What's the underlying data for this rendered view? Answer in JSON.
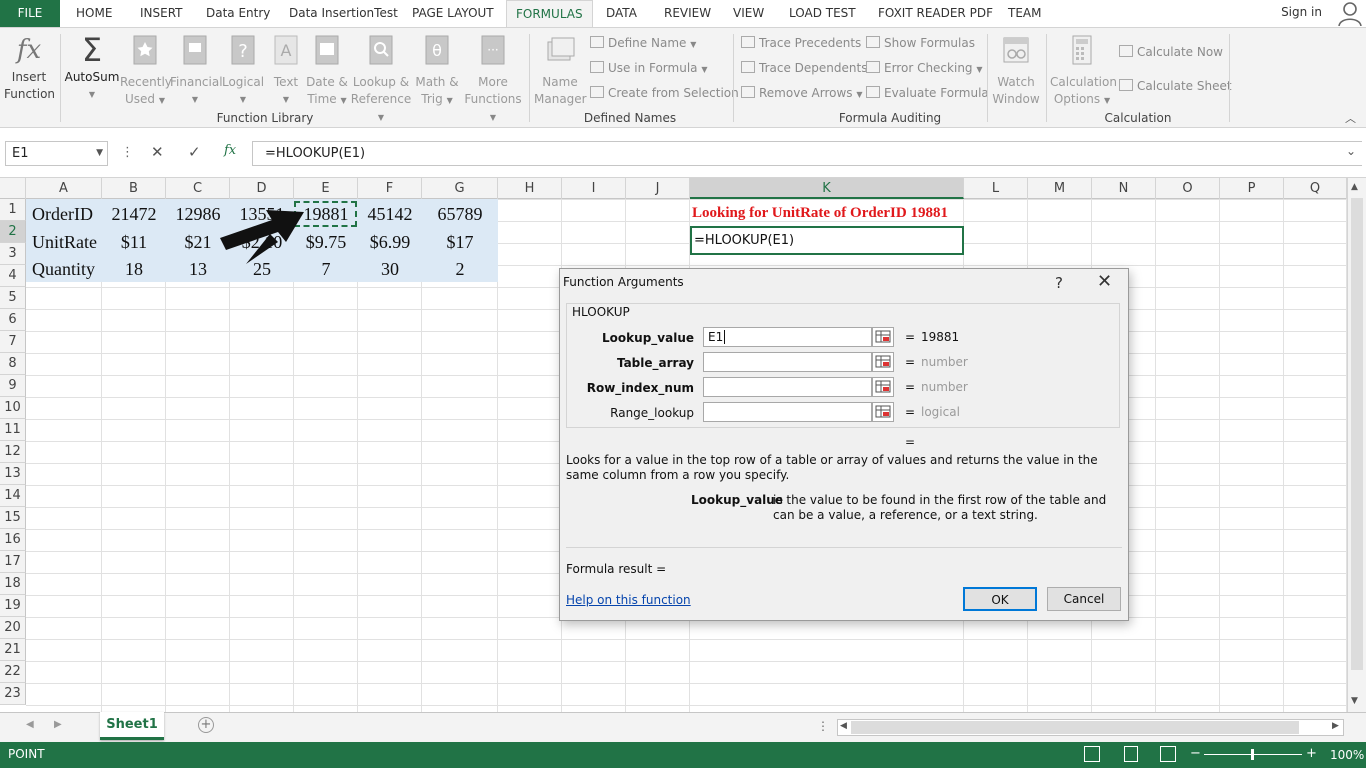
{
  "ribbon_tabs": [
    "FILE",
    "HOME",
    "INSERT",
    "Data Entry",
    "Data InsertionTest",
    "PAGE LAYOUT",
    "FORMULAS",
    "DATA",
    "REVIEW",
    "VIEW",
    "LOAD TEST",
    "FOXIT READER PDF",
    "TEAM"
  ],
  "active_tab": "FORMULAS",
  "sign_in": "Sign in",
  "ribbon": {
    "insert_function": [
      "Insert",
      "Function"
    ],
    "autosum": "AutoSum",
    "recently_used": [
      "Recently",
      "Used"
    ],
    "financial": "Financial",
    "logical": "Logical",
    "text": "Text",
    "date_time": [
      "Date &",
      "Time"
    ],
    "lookup_ref": [
      "Lookup &",
      "Reference"
    ],
    "math_trig": [
      "Math &",
      "Trig"
    ],
    "more_functions": [
      "More",
      "Functions"
    ],
    "group_function_library": "Function Library",
    "name_manager": [
      "Name",
      "Manager"
    ],
    "define_name": "Define Name",
    "use_in_formula": "Use in Formula",
    "create_from_selection": "Create from Selection",
    "group_defined_names": "Defined Names",
    "trace_precedents": "Trace Precedents",
    "trace_dependents": "Trace Dependents",
    "remove_arrows": "Remove Arrows",
    "show_formulas": "Show Formulas",
    "error_checking": "Error Checking",
    "evaluate_formula": "Evaluate Formula",
    "watch_window": [
      "Watch",
      "Window"
    ],
    "group_formula_auditing": "Formula Auditing",
    "calculation_options": [
      "Calculation",
      "Options"
    ],
    "calculate_now": "Calculate Now",
    "calculate_sheet": "Calculate Sheet",
    "group_calculation": "Calculation"
  },
  "name_box": "E1",
  "formula_bar": "=HLOOKUP(E1)",
  "columns": [
    "A",
    "B",
    "C",
    "D",
    "E",
    "F",
    "G",
    "H",
    "I",
    "J",
    "K",
    "L",
    "M",
    "N",
    "O",
    "P",
    "Q"
  ],
  "selected_column": "K",
  "rows": [
    "1",
    "2",
    "3",
    "4",
    "5",
    "6",
    "7",
    "8",
    "9",
    "10",
    "11",
    "12",
    "13",
    "14",
    "15",
    "16",
    "17",
    "18",
    "19",
    "20",
    "21",
    "22",
    "23"
  ],
  "selected_row": "2",
  "table": {
    "row1": [
      "OrderID",
      "21472",
      "12986",
      "13551",
      "19881",
      "45142",
      "65789"
    ],
    "row2": [
      "UnitRate",
      "$11",
      "$21",
      "$2.10",
      "$9.75",
      "$6.99",
      "$17"
    ],
    "row3": [
      "Quantity",
      "18",
      "13",
      "25",
      "7",
      "30",
      "2"
    ]
  },
  "k1_text": "Looking for UnitRate of OrderID 19881",
  "k2_text": "=HLOOKUP(E1)",
  "sheet_tab": "Sheet1",
  "status_mode": "POINT",
  "zoom": "100%",
  "dialog": {
    "title": "Function Arguments",
    "help_glyph": "?",
    "close_glyph": "✕",
    "function_name": "HLOOKUP",
    "args": [
      {
        "label": "Lookup_value",
        "value": "E1",
        "eq": "=",
        "result": "19881"
      },
      {
        "label": "Table_array",
        "value": "",
        "eq": "=",
        "result": "number"
      },
      {
        "label": "Row_index_num",
        "value": "",
        "eq": "=",
        "result": "number"
      },
      {
        "label": "Range_lookup",
        "value": "",
        "eq": "=",
        "result": "logical"
      }
    ],
    "result_eq": "=",
    "description": "Looks for a value in the top row of a table or array of values and returns the value in the same column from a row you specify.",
    "arg_desc_label": "Lookup_value",
    "arg_desc_text": "is the value to be found in the first row of the table and can be a value, a reference, or a text string.",
    "formula_result": "Formula result =",
    "help_link": "Help on this function",
    "ok": "OK",
    "cancel": "Cancel"
  },
  "colors": {
    "accent": "#217346",
    "red_text": "#e0181b",
    "data_fill": "#dce9f5"
  }
}
